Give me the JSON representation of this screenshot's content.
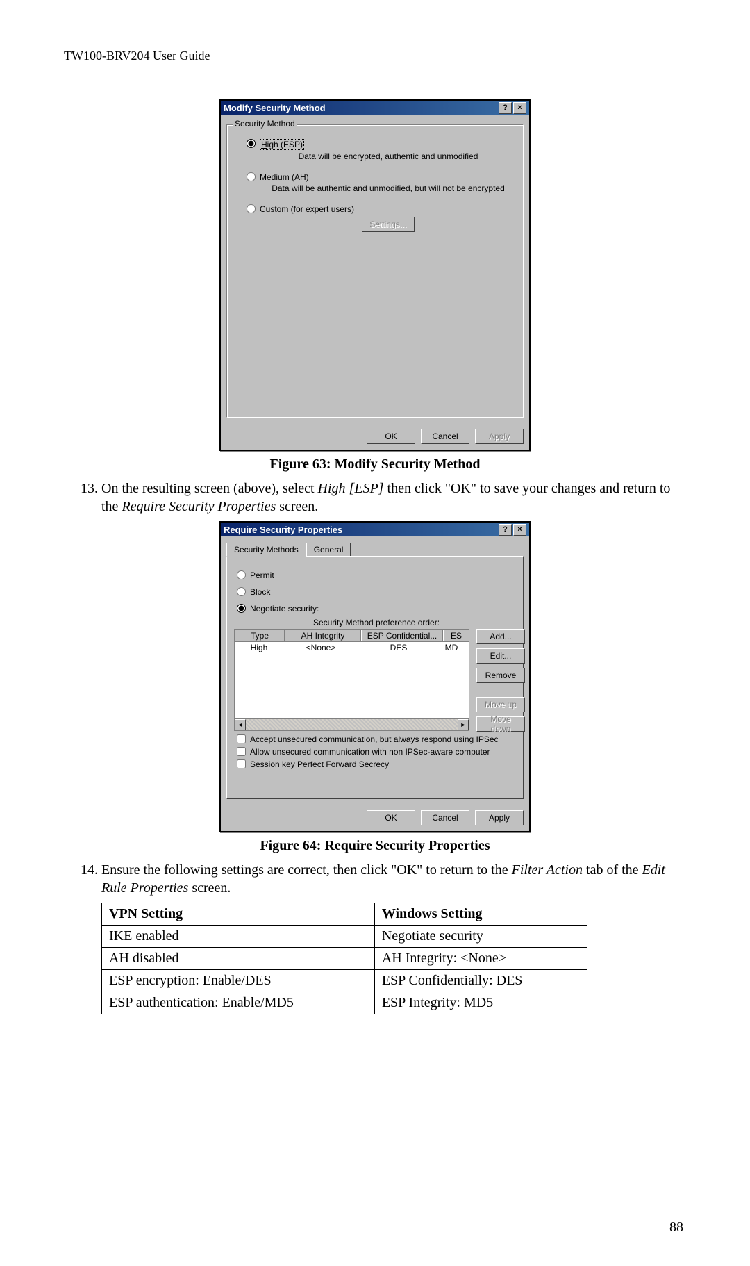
{
  "header": "TW100-BRV204 User Guide",
  "page_number": "88",
  "dialog1": {
    "title": "Modify Security Method",
    "group_label": "Security Method",
    "options": [
      {
        "label_html": "<u>H</u>igh (ESP)",
        "label_plain": "High (ESP)",
        "desc": "Data will be encrypted, authentic and unmodified",
        "selected": true,
        "boxed": true
      },
      {
        "label_html": "<u>M</u>edium (AH)",
        "label_plain": "Medium (AH)",
        "desc": "Data will be authentic and unmodified, but will not be encrypted",
        "selected": false,
        "boxed": false
      },
      {
        "label_html": "<u>C</u>ustom (for expert users)",
        "label_plain": "Custom (for expert users)",
        "desc": "",
        "selected": false,
        "boxed": false
      }
    ],
    "settings_btn": "Settings...",
    "buttons": {
      "ok": "OK",
      "cancel": "Cancel",
      "apply": "Apply"
    }
  },
  "caption1": "Figure 63: Modify Security Method",
  "step13_pre": "On the resulting screen (above), select ",
  "step13_em": "High [ESP]",
  "step13_mid": " then click \"OK\" to save your changes and return to the ",
  "step13_em2": "Require Security Properties",
  "step13_post": " screen.",
  "dialog2": {
    "title": "Require Security Properties",
    "tabs": [
      "Security Methods",
      "General"
    ],
    "radios": [
      "Permit",
      "Block",
      "Negotiate security:"
    ],
    "order_label": "Security Method preference order:",
    "columns": [
      "Type",
      "AH Integrity",
      "ESP Confidential...",
      "ES"
    ],
    "row": [
      "High",
      "<None>",
      "DES",
      "MD"
    ],
    "side_buttons": [
      "Add...",
      "Edit...",
      "Remove",
      "Move up",
      "Move down"
    ],
    "checkboxes": [
      "Accept unsecured communication, but always respond using IPSec",
      "Allow unsecured communication with non IPSec-aware computer",
      "Session key Perfect Forward Secrecy"
    ],
    "buttons": {
      "ok": "OK",
      "cancel": "Cancel",
      "apply": "Apply"
    }
  },
  "caption2": "Figure 64: Require Security Properties",
  "step14_pre": "Ensure the following settings are correct, then click \"OK\" to return to the ",
  "step14_em": "Filter Action",
  "step14_mid": " tab of the ",
  "step14_em2": "Edit Rule Properties",
  "step14_post": " screen.",
  "table": {
    "headers": [
      "VPN Setting",
      "Windows Setting"
    ],
    "rows": [
      [
        "IKE enabled",
        "Negotiate security"
      ],
      [
        "AH disabled",
        "AH Integrity: <None>"
      ],
      [
        "ESP encryption: Enable/DES",
        "ESP Confidentially: DES"
      ],
      [
        "ESP authentication: Enable/MD5",
        "ESP Integrity: MD5"
      ]
    ]
  }
}
